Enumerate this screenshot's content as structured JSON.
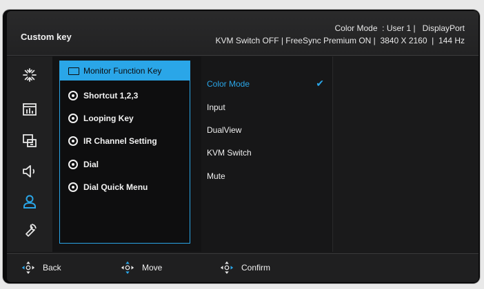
{
  "header": {
    "title": "Custom key",
    "status_line1": "Color Mode  : User 1 |   DisplayPort",
    "status_line2": "KVM Switch OFF | FreeSync Premium ON |  3840 X 2160  |  144 Hz"
  },
  "sidebar": {
    "icons": [
      "brightness-icon",
      "display-grid-icon",
      "picture-in-picture-icon",
      "speaker-icon",
      "user-icon",
      "wrench-icon"
    ],
    "selected": "user-icon",
    "accent_color": "#2aa6e8"
  },
  "submenu": {
    "items": [
      {
        "label": "Monitor Function Key",
        "icon": "monitor-icon",
        "selected": true
      },
      {
        "label": "Shortcut 1,2,3",
        "icon": "radio-icon"
      },
      {
        "label": "Looping Key",
        "icon": "radio-icon"
      },
      {
        "label": "IR Channel Setting",
        "icon": "radio-icon"
      },
      {
        "label": "Dial",
        "icon": "radio-icon"
      },
      {
        "label": "Dial Quick Menu",
        "icon": "radio-icon"
      }
    ]
  },
  "options": {
    "items": [
      {
        "label": "Color Mode",
        "checked": true
      },
      {
        "label": "Input"
      },
      {
        "label": "DualView"
      },
      {
        "label": "KVM Switch"
      },
      {
        "label": "Mute"
      }
    ],
    "check_glyph": "✔"
  },
  "footer": {
    "back_label": "Back",
    "move_label": "Move",
    "confirm_label": "Confirm"
  }
}
